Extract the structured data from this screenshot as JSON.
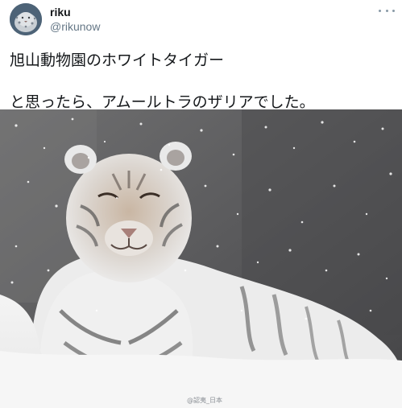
{
  "tweet": {
    "author": {
      "display_name": "riku",
      "handle": "@rikunow",
      "avatar_icon": "snow-leopard-avatar"
    },
    "more_icon": "more-options-icon",
    "text_line_1": "旭山動物園のホワイトタイガー",
    "text_line_2": "と思ったら、アムールトラのザリアでした。",
    "media": {
      "watermark": "@認夷_日本"
    }
  }
}
